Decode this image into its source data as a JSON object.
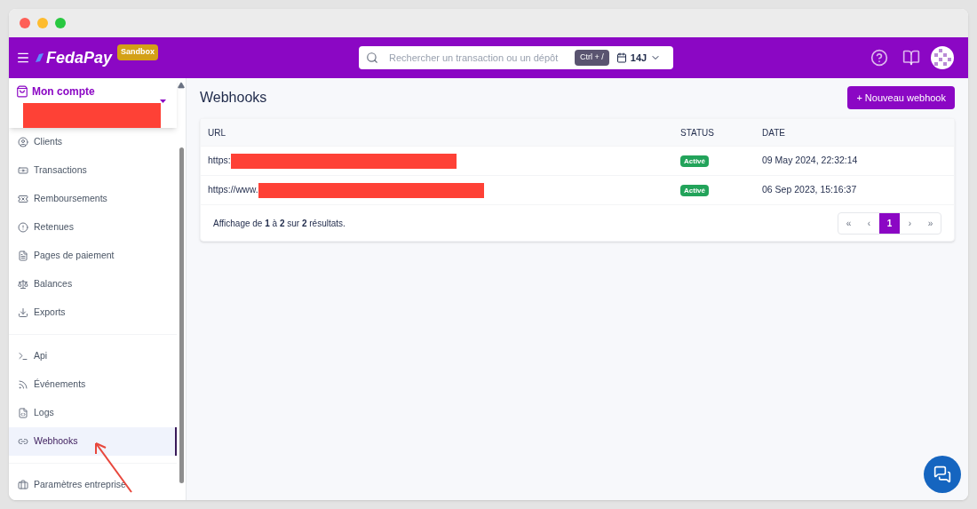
{
  "header": {
    "brand": "FedaPay",
    "badge": "Sandbox",
    "search": {
      "placeholder": "Rechercher un transaction ou un dépôt"
    },
    "shortcut": "Ctrl + /",
    "period": "14J"
  },
  "account": {
    "title": "Mon compte"
  },
  "sidebar": {
    "groups": [
      [
        {
          "label": "Clients",
          "selected": false
        },
        {
          "label": "Transactions",
          "selected": false
        },
        {
          "label": "Remboursements",
          "selected": false
        },
        {
          "label": "Retenues",
          "selected": false
        },
        {
          "label": "Pages de paiement",
          "selected": false
        },
        {
          "label": "Balances",
          "selected": false
        },
        {
          "label": "Exports",
          "selected": false
        }
      ],
      [
        {
          "label": "Api",
          "selected": false
        },
        {
          "label": "Événements",
          "selected": false
        },
        {
          "label": "Logs",
          "selected": false
        },
        {
          "label": "Webhooks",
          "selected": true
        }
      ],
      [
        {
          "label": "Paramètres entreprise",
          "selected": false
        }
      ]
    ]
  },
  "page": {
    "title": "Webhooks",
    "new_button": "+ Nouveau webhook"
  },
  "table": {
    "columns": [
      "URL",
      "STATUS",
      "DATE"
    ],
    "rows": [
      {
        "url": "https:",
        "status": "Activé",
        "date": "09 May 2024, 22:32:14"
      },
      {
        "url": "https://www.",
        "status": "Activé",
        "date": "06 Sep 2023, 15:16:37"
      }
    ],
    "summary": "Affichage de **1** à **2** sur **2** résultats.",
    "pagination": [
      {
        "label": "«",
        "selected": false
      },
      {
        "label": "‹",
        "selected": false
      },
      {
        "label": "1",
        "selected": true
      },
      {
        "label": "›",
        "selected": false
      },
      {
        "label": "»",
        "selected": false
      }
    ]
  }
}
